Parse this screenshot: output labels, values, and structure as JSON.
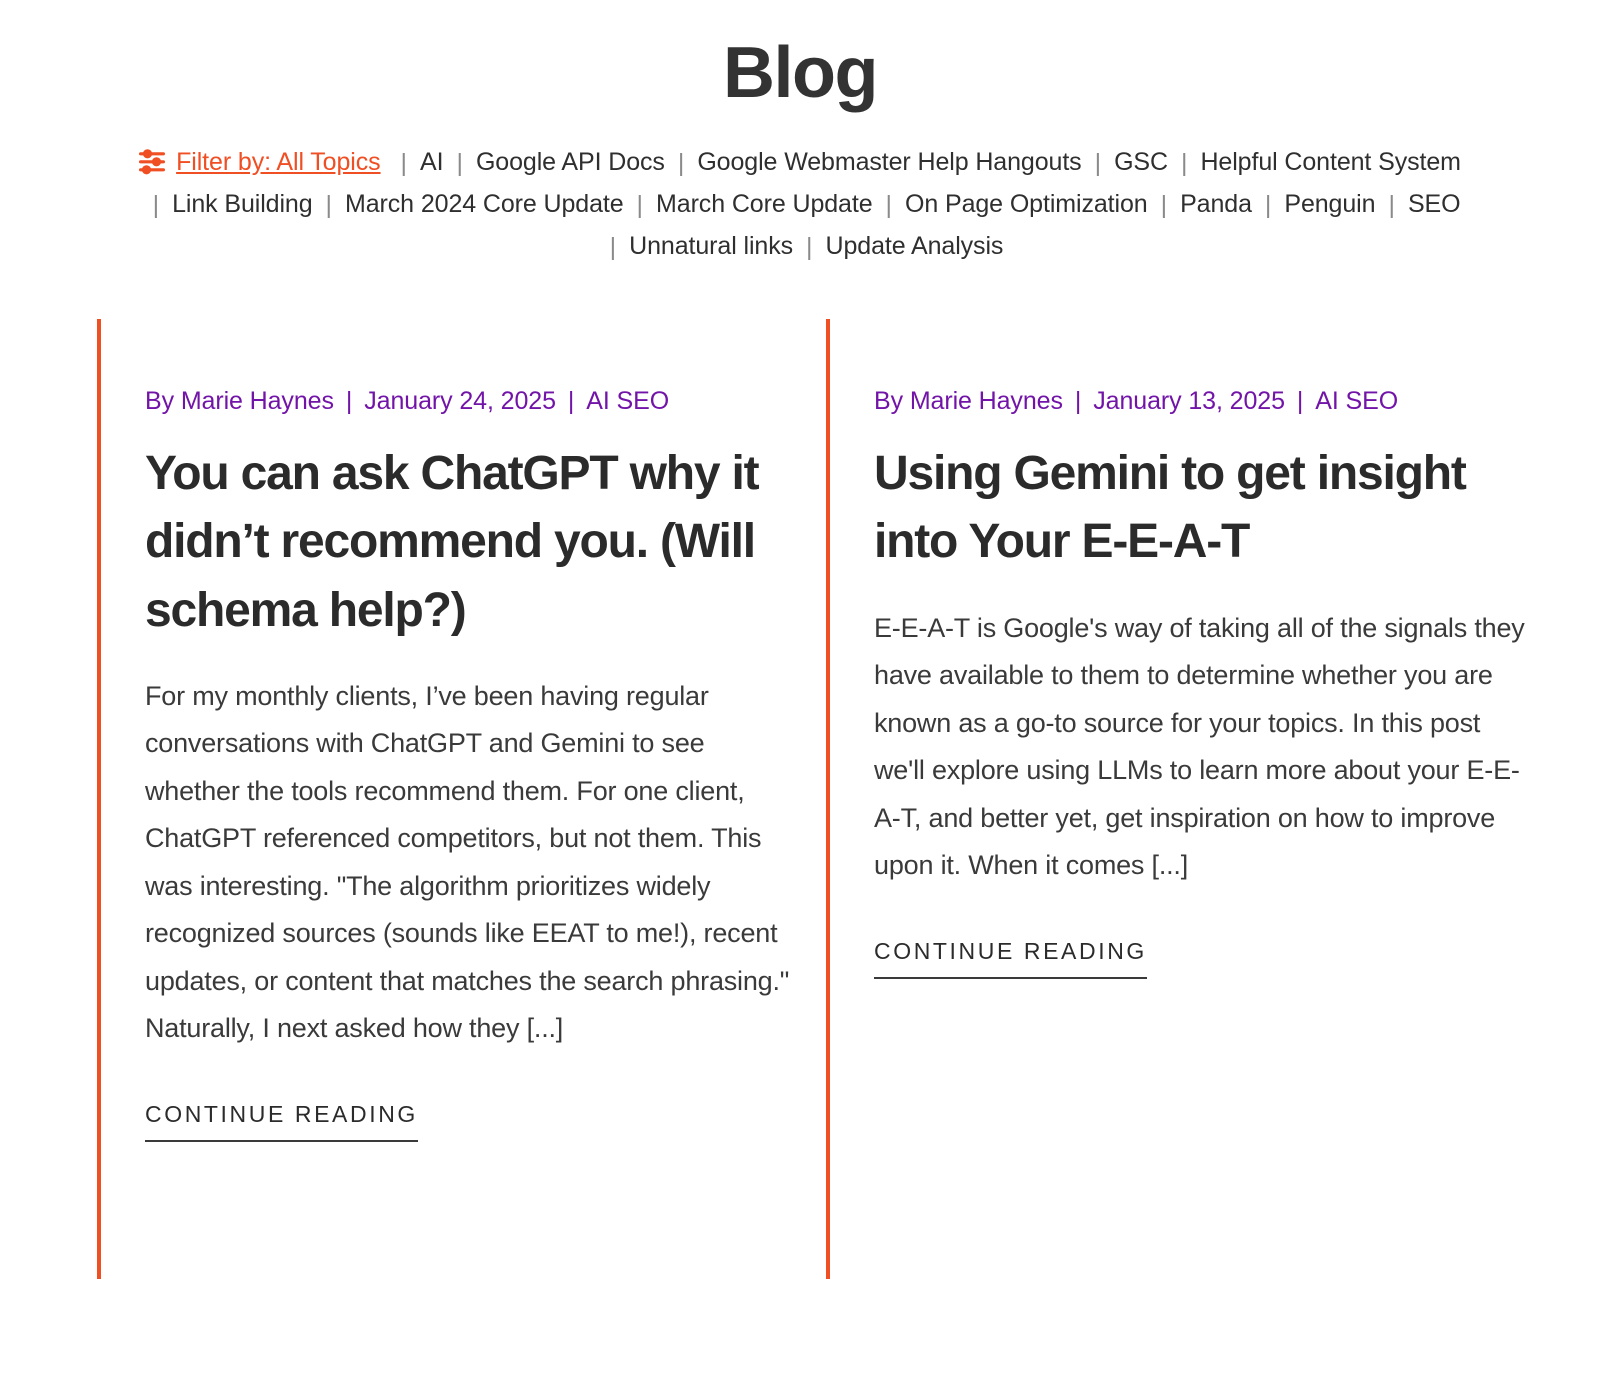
{
  "header": {
    "title": "Blog"
  },
  "filter": {
    "icon": "sliders-filter-icon",
    "label": "Filter by: All Topics",
    "accent_color": "#f04e23",
    "separator": "|",
    "topics": [
      "AI",
      "Google API Docs",
      "Google Webmaster Help Hangouts",
      "GSC",
      "Helpful Content System",
      "Link Building",
      "March 2024 Core Update",
      "March Core Update",
      "On Page Optimization",
      "Panda",
      "Penguin",
      "SEO",
      "Unnatural links",
      "Update Analysis"
    ]
  },
  "posts": [
    {
      "author": "By Marie Haynes",
      "date": "January 24, 2025",
      "category": "AI SEO",
      "meta_separator": "|",
      "title": "You can ask ChatGPT why it didn’t recommend you. (Will schema help?)",
      "excerpt": "For my monthly clients, I’ve been having regular conversations with ChatGPT and Gemini to see whether the tools recommend them. For one client, ChatGPT referenced competitors, but not them. This was interesting. \"The algorithm prioritizes widely recognized sources (sounds like EEAT to me!), recent updates, or content that matches the search phrasing.\" Naturally, I next asked how they [...]",
      "cta": "CONTINUE READING",
      "accent_color": "#f04e23",
      "meta_color": "#7214a8"
    },
    {
      "author": "By Marie Haynes",
      "date": "January 13, 2025",
      "category": "AI SEO",
      "meta_separator": "|",
      "title": "Using Gemini to get insight into Your E-E-A-T",
      "excerpt": "E-E-A-T is Google's way of taking all of the signals they have available to them to determine whether you are known as a go-to source for your topics. In this post we'll explore using LLMs to learn more about your E-E-A-T, and better yet, get inspiration on how to improve upon it. When it comes [...]",
      "cta": "CONTINUE READING",
      "accent_color": "#f04e23",
      "meta_color": "#7214a8"
    }
  ]
}
